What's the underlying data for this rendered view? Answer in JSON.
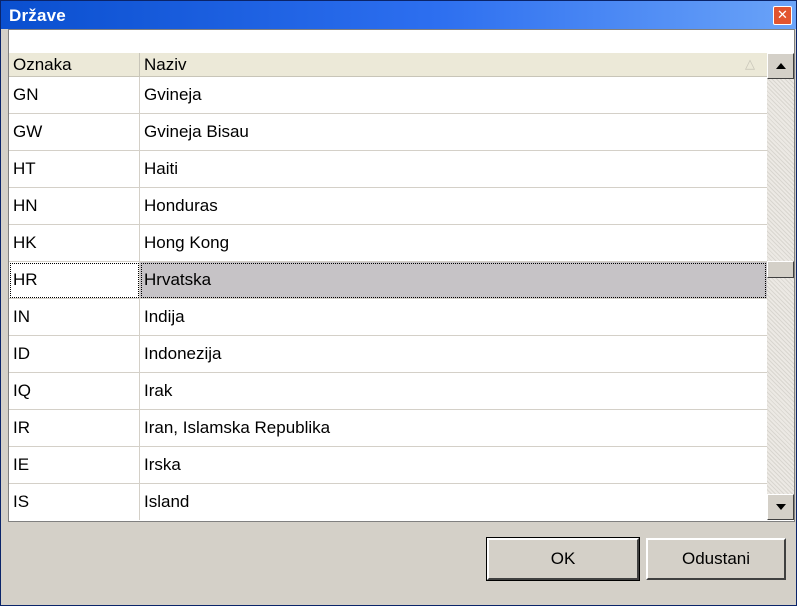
{
  "window": {
    "title": "Države",
    "close_label": "✕"
  },
  "grid": {
    "columns": [
      "Oznaka",
      "Naziv"
    ],
    "sort_indicator": "△",
    "rows": [
      {
        "code": "GN",
        "name": "Gvineja"
      },
      {
        "code": "GW",
        "name": "Gvineja Bisau"
      },
      {
        "code": "HT",
        "name": "Haiti"
      },
      {
        "code": "HN",
        "name": "Honduras"
      },
      {
        "code": "HK",
        "name": "Hong Kong"
      },
      {
        "code": "HR",
        "name": "Hrvatska"
      },
      {
        "code": "IN",
        "name": "Indija"
      },
      {
        "code": "ID",
        "name": "Indonezija"
      },
      {
        "code": "IQ",
        "name": "Irak"
      },
      {
        "code": "IR",
        "name": "Iran, Islamska Republika"
      },
      {
        "code": "IE",
        "name": "Irska"
      },
      {
        "code": "IS",
        "name": "Island"
      }
    ],
    "selected_code": "HR"
  },
  "buttons": {
    "ok": "OK",
    "cancel": "Odustani"
  },
  "colors": {
    "title_bar": "#0a4fcf",
    "selected_row": "#c6c3c6",
    "dialog_bg": "#d4d0c8"
  }
}
